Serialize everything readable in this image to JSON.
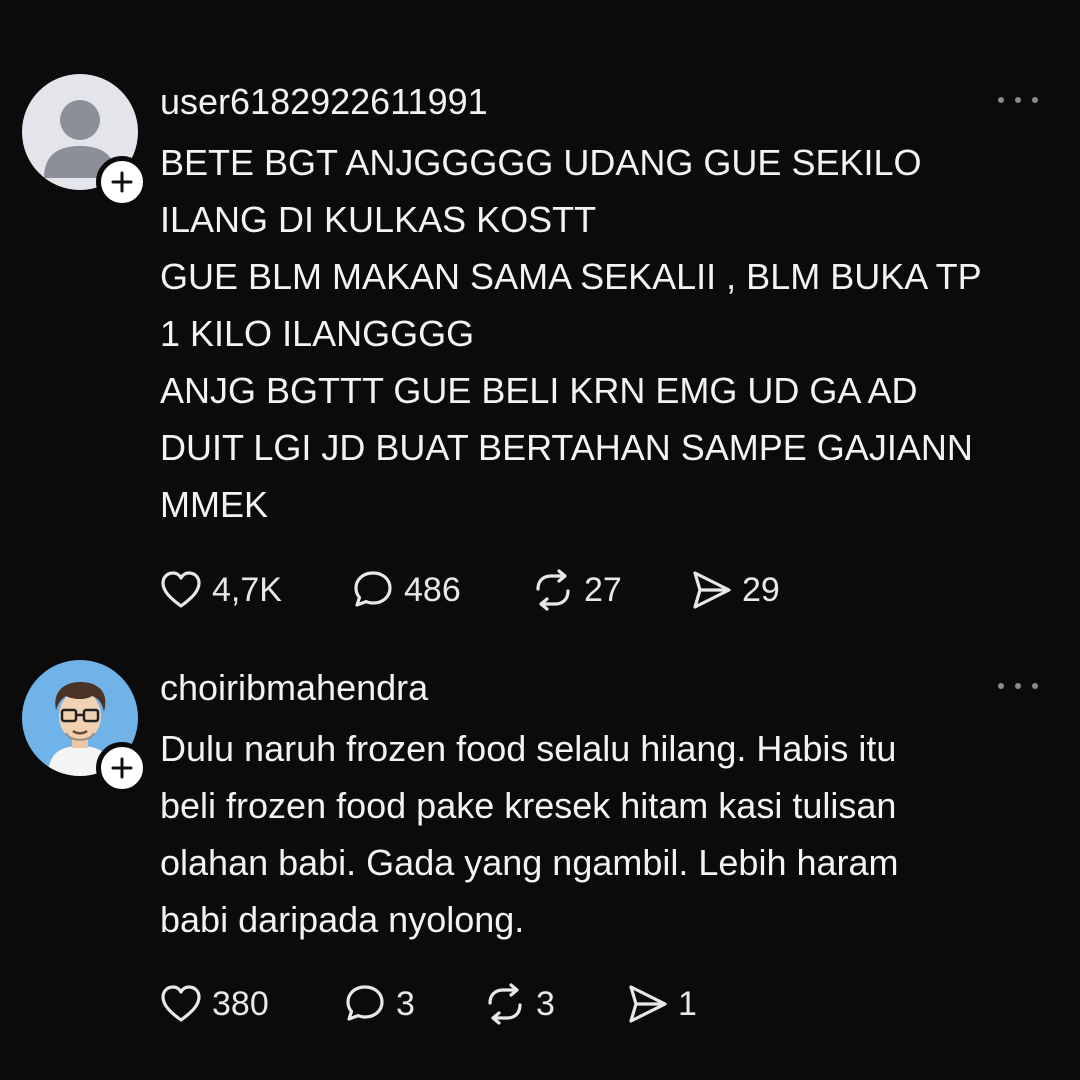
{
  "posts": [
    {
      "username": "user6182922611991",
      "avatar_icon": "default-user-avatar-icon",
      "lines": [
        "BETE BGT ANJGGGGG UDANG GUE SEKILO",
        "ILANG DI KULKAS KOSTT",
        "GUE BLM MAKAN SAMA SEKALII , BLM BUKA TP",
        "1 KILO ILANGGGG",
        "ANJG BGTTT GUE BELI KRN EMG UD GA AD",
        "DUIT LGI JD BUAT BERTAHAN SAMPE GAJIANN",
        "MMEK"
      ],
      "likes": "4,7K",
      "comments": "486",
      "reposts": "27",
      "shares": "29"
    },
    {
      "username": "choiribmahendra",
      "avatar_icon": "cartoon-man-glasses-avatar-icon",
      "lines": [
        "Dulu naruh frozen food selalu hilang. Habis itu",
        "beli frozen food pake kresek hitam kasi tulisan",
        "olahan babi. Gada yang ngambil. Lebih haram",
        "babi daripada nyolong."
      ],
      "likes": "380",
      "comments": "3",
      "reposts": "3",
      "shares": "1"
    }
  ],
  "colors": {
    "background": "#0b0b0b",
    "text": "#f3f3f3",
    "muted_icon": "#8a8a8a",
    "avatar_blue": "#6fb3e8"
  }
}
